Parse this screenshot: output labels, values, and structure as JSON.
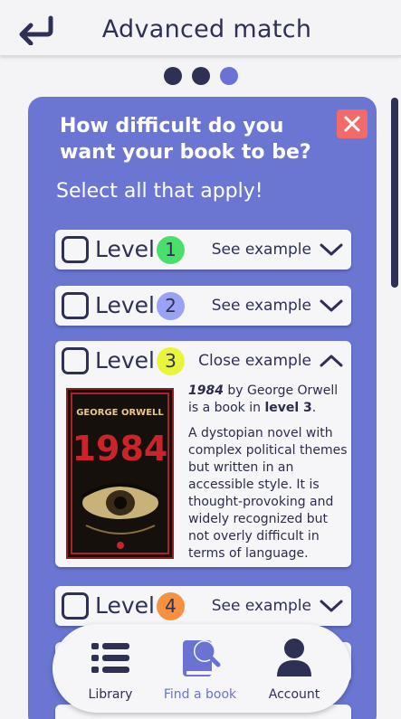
{
  "header": {
    "title": "Advanced match",
    "back_icon": "back-arrow-icon"
  },
  "progress": {
    "step_count": 3,
    "current_step": 3
  },
  "panel": {
    "question": "How difficult do you want your book to be?",
    "subtitle": "Select all that apply!",
    "close_icon": "close-icon",
    "levels": [
      {
        "label": "Level",
        "number": "1",
        "badge_color": "#4ade6b",
        "toggle": "See example",
        "checked": false,
        "expanded": false
      },
      {
        "label": "Level",
        "number": "2",
        "badge_color": "#9aa2f5",
        "toggle": "See example",
        "checked": false,
        "expanded": false
      },
      {
        "label": "Level",
        "number": "3",
        "badge_color": "#e8f53a",
        "toggle": "Close example",
        "checked": false,
        "expanded": true
      },
      {
        "label": "Level",
        "number": "4",
        "badge_color": "#f7913f",
        "toggle": "See example",
        "checked": false,
        "expanded": false
      }
    ],
    "example": {
      "book_title": "1984",
      "by_text": " by George Orwell is a book in ",
      "level_text": "level 3",
      "period": ".",
      "description": "A dystopian novel with complex political themes but written in an accessible style. It is thought-provoking and widely recognized but not overly difficult in terms of language.",
      "cover_author": "GEORGE ORWELL",
      "cover_title": "1984"
    }
  },
  "nav": {
    "items": [
      {
        "label": "Library",
        "icon": "list-icon",
        "active": false
      },
      {
        "label": "Find a book",
        "icon": "book-search-icon",
        "active": true
      },
      {
        "label": "Account",
        "icon": "user-icon",
        "active": false
      }
    ]
  },
  "colors": {
    "accent": "#6b76d2",
    "dark": "#2e3154",
    "close": "#f36a6a"
  }
}
